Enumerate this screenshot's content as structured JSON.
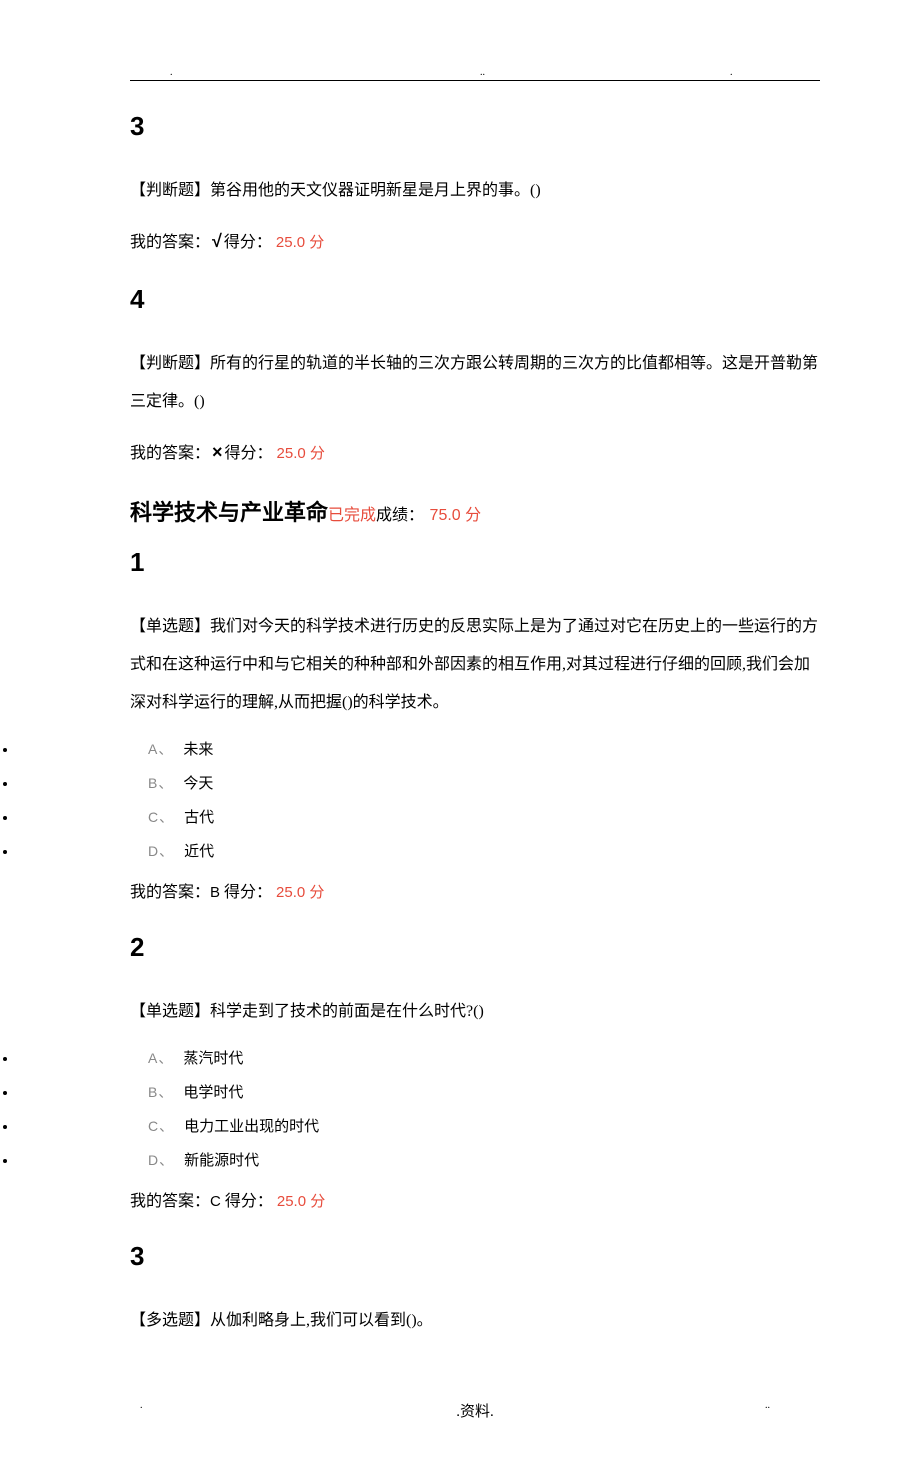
{
  "q3": {
    "num": "3",
    "type": "【判断题】",
    "text": "第谷用他的天文仪器证明新星是月上界的事。()",
    "answer_prefix": "我的答案：",
    "symbol": "√",
    "score_label": "得分：",
    "score": "25.0 分"
  },
  "q4": {
    "num": "4",
    "type": "【判断题】",
    "text": "所有的行星的轨道的半长轴的三次方跟公转周期的三次方的比值都相等。这是开普勒第三定律。()",
    "answer_prefix": "我的答案：",
    "symbol": "×",
    "score_label": "得分：",
    "score": "25.0 分"
  },
  "section": {
    "title": "科学技术与产业革命",
    "status": "已完成",
    "score_label": "成绩：",
    "score": "75.0 分"
  },
  "q1b": {
    "num": "1",
    "type": "【单选题】",
    "text": "我们对今天的科学技术进行历史的反思实际上是为了通过对它在历史上的一些运行的方式和在这种运行中和与它相关的种种部和外部因素的相互作用,对其过程进行仔细的回顾,我们会加深对科学运行的理解,从而把握()的科学技术。",
    "options": [
      {
        "label": "A、",
        "text": "未来"
      },
      {
        "label": "B、",
        "text": "今天"
      },
      {
        "label": "C、",
        "text": "古代"
      },
      {
        "label": "D、",
        "text": "近代"
      }
    ],
    "answer_prefix": "我的答案：",
    "answer": "B",
    "score_label": " 得分：",
    "score": "25.0 分"
  },
  "q2b": {
    "num": "2",
    "type": "【单选题】",
    "text": "科学走到了技术的前面是在什么时代?()",
    "options": [
      {
        "label": "A、",
        "text": "蒸汽时代"
      },
      {
        "label": "B、",
        "text": "电学时代"
      },
      {
        "label": "C、",
        "text": "电力工业出现的时代"
      },
      {
        "label": "D、",
        "text": "新能源时代"
      }
    ],
    "answer_prefix": "我的答案：",
    "answer": "C",
    "score_label": " 得分：",
    "score": "25.0 分"
  },
  "q3b": {
    "num": "3",
    "type": "【多选题】",
    "text": "从伽利略身上,我们可以看到()。"
  },
  "footer": {
    "text": ".资料."
  }
}
